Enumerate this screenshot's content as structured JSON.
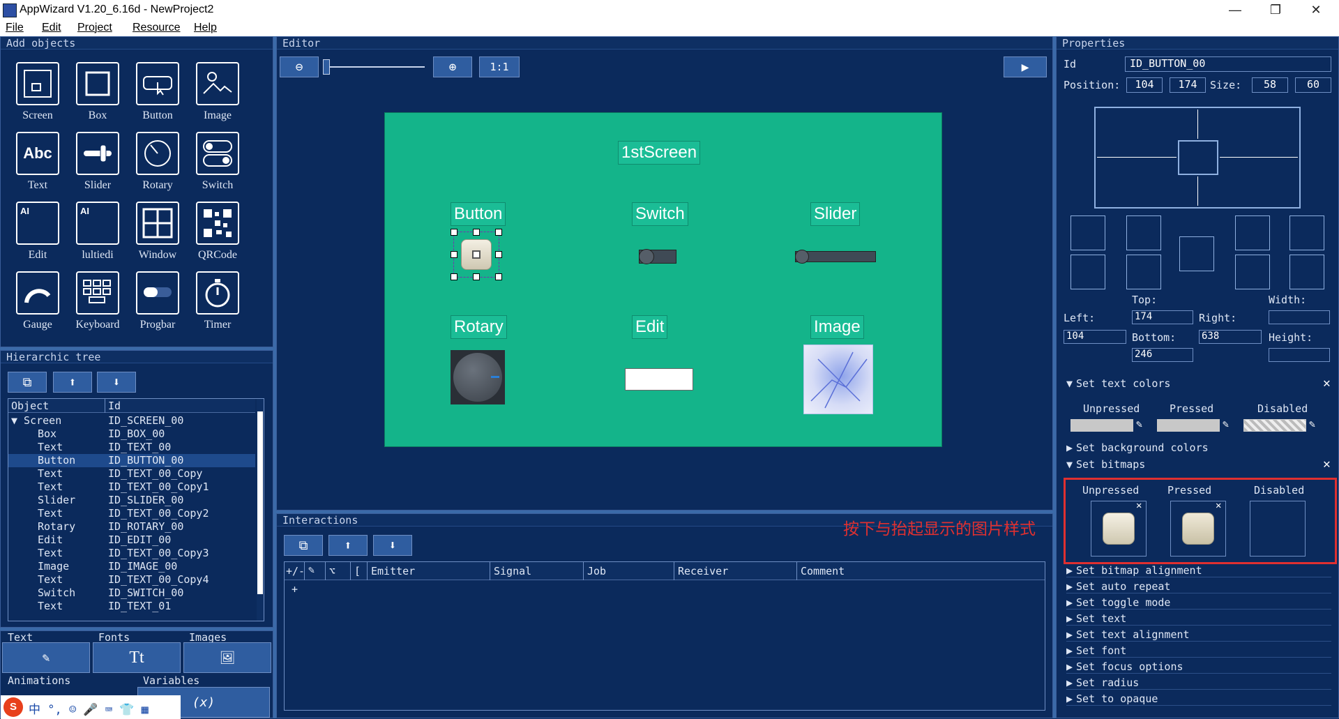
{
  "window": {
    "title": "AppWizard V1.20_6.16d - NewProject2",
    "minimize": "—",
    "restore": "❐",
    "close": "✕"
  },
  "menu": [
    "File",
    "Edit",
    "Project",
    "Resource",
    "Help"
  ],
  "add_objects": {
    "title": "Add objects",
    "tools": [
      {
        "label": "Screen",
        "icon": "screen-icon"
      },
      {
        "label": "Box",
        "icon": "box-icon"
      },
      {
        "label": "Button",
        "icon": "button-icon"
      },
      {
        "label": "Image",
        "icon": "image-icon"
      },
      {
        "label": "Text",
        "icon": "text-icon",
        "glyph": "Abc"
      },
      {
        "label": "Slider",
        "icon": "slider-icon"
      },
      {
        "label": "Rotary",
        "icon": "rotary-icon"
      },
      {
        "label": "Switch",
        "icon": "switch-icon"
      },
      {
        "label": "Edit",
        "icon": "edit-icon",
        "glyph": "AI"
      },
      {
        "label": "lultiedi",
        "icon": "multiedit-icon",
        "glyph": "AI"
      },
      {
        "label": "Window",
        "icon": "window-icon"
      },
      {
        "label": "QRCode",
        "icon": "qrcode-icon"
      },
      {
        "label": "Gauge",
        "icon": "gauge-icon"
      },
      {
        "label": "Keyboard",
        "icon": "keyboard-icon"
      },
      {
        "label": "Progbar",
        "icon": "progbar-icon"
      },
      {
        "label": "Timer",
        "icon": "timer-icon"
      }
    ]
  },
  "hierarchy": {
    "title": "Hierarchic tree",
    "col_object": "Object",
    "col_id": "Id",
    "rows": [
      {
        "object": "Screen",
        "id": "ID_SCREEN_00",
        "root": true
      },
      {
        "object": "Box",
        "id": "ID_BOX_00"
      },
      {
        "object": "Text",
        "id": "ID_TEXT_00"
      },
      {
        "object": "Button",
        "id": "ID_BUTTON_00",
        "selected": true
      },
      {
        "object": "Text",
        "id": "ID_TEXT_00_Copy"
      },
      {
        "object": "Text",
        "id": "ID_TEXT_00_Copy1"
      },
      {
        "object": "Slider",
        "id": "ID_SLIDER_00"
      },
      {
        "object": "Text",
        "id": "ID_TEXT_00_Copy2"
      },
      {
        "object": "Rotary",
        "id": "ID_ROTARY_00"
      },
      {
        "object": "Edit",
        "id": "ID_EDIT_00"
      },
      {
        "object": "Text",
        "id": "ID_TEXT_00_Copy3"
      },
      {
        "object": "Image",
        "id": "ID_IMAGE_00"
      },
      {
        "object": "Text",
        "id": "ID_TEXT_00_Copy4"
      },
      {
        "object": "Switch",
        "id": "ID_SWITCH_00"
      },
      {
        "object": "Text",
        "id": "ID_TEXT_01"
      }
    ]
  },
  "resources": {
    "tabs": [
      "Text",
      "Fonts",
      "Images"
    ],
    "tabs2": [
      "Animations",
      "Variables"
    ],
    "var_glyph": "(x)",
    "text_glyph": "Tt"
  },
  "ime": {
    "glyphs": "中 °, ☺ 🎤 ⌨ 👕 ▦"
  },
  "editor": {
    "title": "Editor",
    "zoom_label": "1:1",
    "labels": {
      "screen": "1stScreen",
      "button": "Button",
      "switch": "Switch",
      "slider": "Slider",
      "rotary": "Rotary",
      "edit": "Edit",
      "image": "Image"
    }
  },
  "interactions": {
    "title": "Interactions",
    "annotation": "按下与抬起显示的图片样式",
    "cols": [
      "+/-",
      "",
      "⌥",
      "[",
      "Emitter",
      "Signal",
      "Job",
      "Receiver",
      "Comment"
    ],
    "add_row": "+"
  },
  "properties": {
    "title": "Properties",
    "id_label": "Id",
    "id_value": "ID_BUTTON_00",
    "position_label": "Position:",
    "pos_x": "104",
    "pos_y": "174",
    "size_label": "Size:",
    "size_w": "58",
    "size_h": "60",
    "top_label": "Top:",
    "width_label": "Width:",
    "left_label": "Left:",
    "right_label": "Right:",
    "bottom_label": "Bottom:",
    "height_label": "Height:",
    "top_value": "174",
    "left_value": "104",
    "bottom_value": "638",
    "bottom2_value": "246",
    "sections": {
      "text_colors": "Set text colors",
      "bg_colors": "Set background colors",
      "bitmaps": "Set bitmaps"
    },
    "states": [
      "Unpressed",
      "Pressed",
      "Disabled"
    ],
    "more_sections": [
      "Set bitmap alignment",
      "Set auto repeat",
      "Set toggle mode",
      "Set text",
      "Set text alignment",
      "Set font",
      "Set focus options",
      "Set radius",
      "Set to opaque"
    ],
    "colors": {
      "accent": "#0b2a5c",
      "canvas": "#14b48a",
      "highlight_red": "#e03030"
    }
  }
}
